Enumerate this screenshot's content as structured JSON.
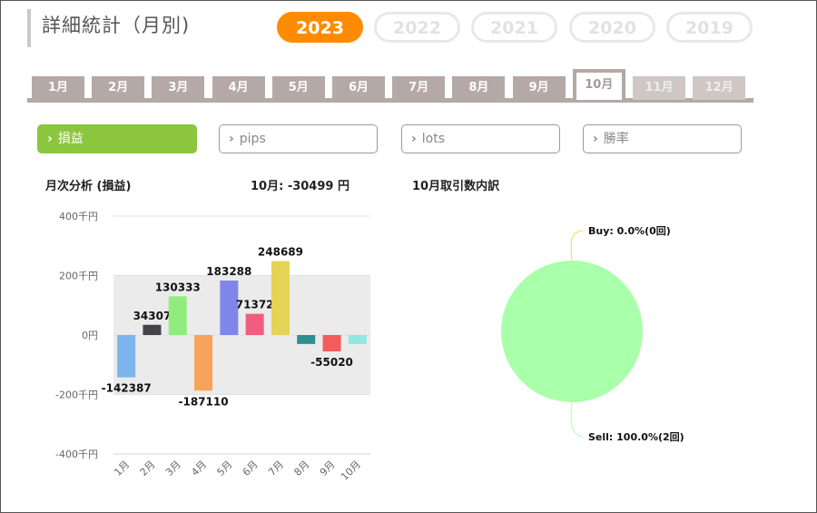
{
  "header": {
    "title": "詳細統計（月別)"
  },
  "years": [
    {
      "label": "2023",
      "active": true
    },
    {
      "label": "2022",
      "active": false
    },
    {
      "label": "2021",
      "active": false
    },
    {
      "label": "2020",
      "active": false
    },
    {
      "label": "2019",
      "active": false
    }
  ],
  "months": [
    {
      "label": "1月",
      "state": "normal"
    },
    {
      "label": "2月",
      "state": "normal"
    },
    {
      "label": "3月",
      "state": "normal"
    },
    {
      "label": "4月",
      "state": "normal"
    },
    {
      "label": "5月",
      "state": "normal"
    },
    {
      "label": "6月",
      "state": "normal"
    },
    {
      "label": "7月",
      "state": "normal"
    },
    {
      "label": "8月",
      "state": "normal"
    },
    {
      "label": "9月",
      "state": "normal"
    },
    {
      "label": "10月",
      "state": "active"
    },
    {
      "label": "11月",
      "state": "disabled"
    },
    {
      "label": "12月",
      "state": "disabled"
    }
  ],
  "metrics": [
    {
      "label": "損益",
      "active": true,
      "chevron": "›"
    },
    {
      "label": "pips",
      "active": false,
      "chevron": "›"
    },
    {
      "label": "lots",
      "active": false,
      "chevron": "›"
    },
    {
      "label": "勝率",
      "active": false,
      "chevron": "›"
    }
  ],
  "monthly_analysis": {
    "title": "月次分析 (損益)",
    "summary": "10月: -30499 円"
  },
  "breakdown": {
    "title": "10月取引数内訳"
  },
  "chart_data": [
    {
      "type": "bar",
      "categories": [
        "1月",
        "2月",
        "3月",
        "4月",
        "5月",
        "6月",
        "7月",
        "8月",
        "9月",
        "10月"
      ],
      "values": [
        -142387,
        34307,
        130333,
        -187110,
        183288,
        71372,
        248689,
        -30000,
        -55020,
        -30499
      ],
      "labels": [
        "-142387",
        "34307",
        "130333",
        "-187110",
        "183288",
        "71372",
        "248689",
        "",
        "-55020",
        ""
      ],
      "colors": [
        "#7cb5ec",
        "#434348",
        "#90ed7d",
        "#f7a35c",
        "#8085e9",
        "#f15c80",
        "#e4d354",
        "#2b908f",
        "#f45b5b",
        "#91e8e1"
      ],
      "ylim": [
        -400000,
        400000
      ],
      "yticks": [
        400000,
        200000,
        0,
        -200000,
        -400000
      ],
      "ytick_labels": [
        "400千円",
        "200千円",
        "0円",
        "-200千円",
        "-400千円"
      ],
      "band_color": "#ebebeb"
    },
    {
      "type": "pie",
      "slices": [
        {
          "label": "Buy: 0.0%(0回)",
          "value": 0,
          "color": "#ffd24d"
        },
        {
          "label": "Sell: 100.0%(2回)",
          "value": 100,
          "color": "#aaffaa"
        }
      ]
    }
  ]
}
